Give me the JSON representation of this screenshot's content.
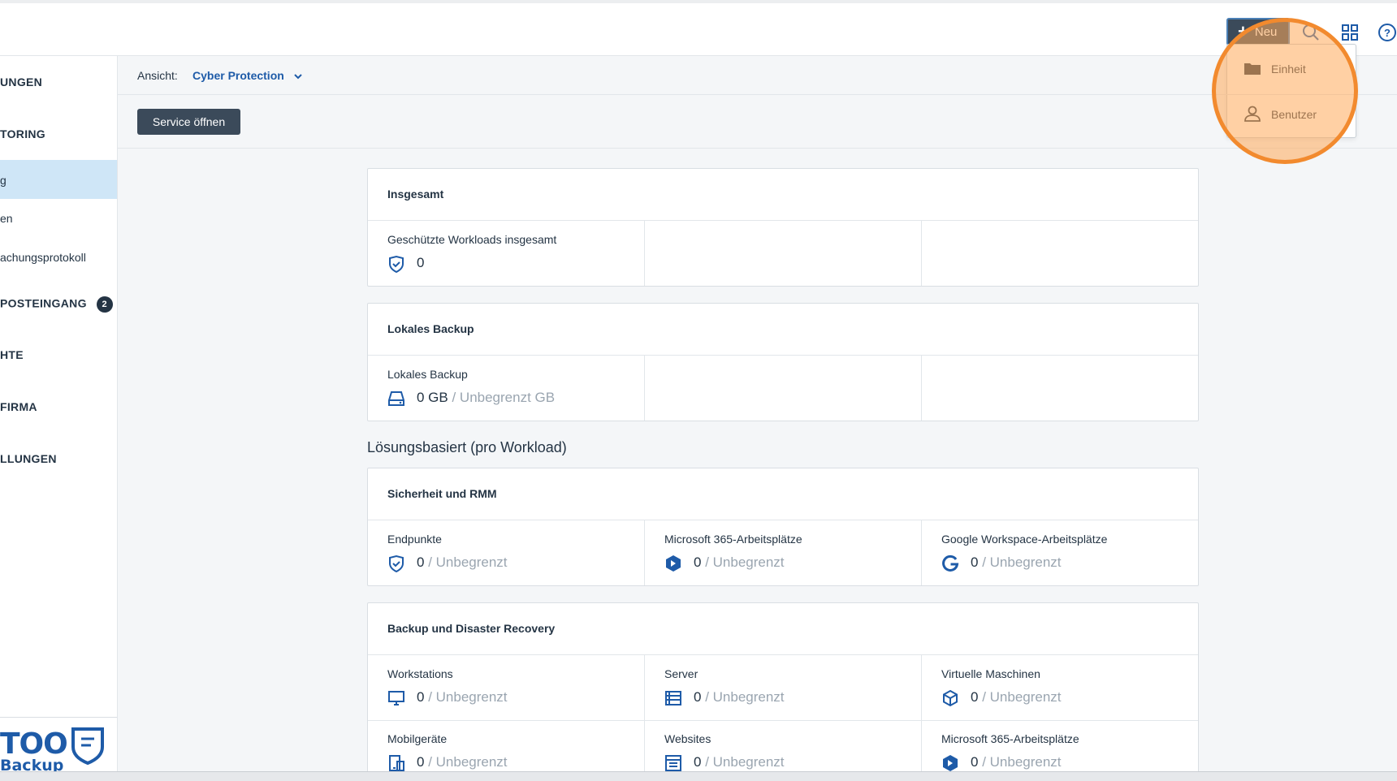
{
  "topbar": {
    "new_label": "Neu",
    "icons": [
      "search-icon",
      "grid-icon",
      "help-icon"
    ]
  },
  "dropdown": {
    "items": [
      {
        "label": "Einheit",
        "icon": "folder-icon"
      },
      {
        "label": "Benutzer",
        "icon": "user-icon"
      }
    ]
  },
  "sidebar": {
    "items": [
      {
        "label": "UNGEN"
      },
      {
        "label": "TORING"
      },
      {
        "label": "g"
      },
      {
        "label": "en"
      },
      {
        "label": "achungsprotokoll"
      },
      {
        "label": "POSTEINGANG",
        "badge": "2"
      },
      {
        "label": "HTE"
      },
      {
        "label": "FIRMA"
      },
      {
        "label": "LLUNGEN"
      }
    ],
    "logo_line1": "TOO",
    "logo_line2": "Backup"
  },
  "viewbar": {
    "label": "Ansicht:",
    "value": "Cyber Protection"
  },
  "service_button": "Service öffnen",
  "cards": {
    "insgesamt": {
      "title": "Insgesamt",
      "cells": [
        {
          "label": "Geschützte Workloads insgesamt",
          "value": "0",
          "limit": "",
          "icon": "shield-icon"
        }
      ]
    },
    "lokales_backup": {
      "title": "Lokales Backup",
      "cells": [
        {
          "label": "Lokales Backup",
          "value": "0 GB",
          "limit": " / Unbegrenzt GB",
          "icon": "drive-icon"
        }
      ]
    },
    "section_title": "Lösungsbasiert (pro Workload)",
    "sicherheit": {
      "title": "Sicherheit und RMM",
      "cells": [
        {
          "label": "Endpunkte",
          "value": "0",
          "limit": " / Unbegrenzt",
          "icon": "shield-icon"
        },
        {
          "label": "Microsoft 365-Arbeitsplätze",
          "value": "0",
          "limit": " / Unbegrenzt",
          "icon": "m365-icon"
        },
        {
          "label": "Google Workspace-Arbeitsplätze",
          "value": "0",
          "limit": " / Unbegrenzt",
          "icon": "google-icon"
        }
      ]
    },
    "backup_dr": {
      "title": "Backup und Disaster Recovery",
      "cells": [
        {
          "label": "Workstations",
          "value": "0",
          "limit": " / Unbegrenzt",
          "icon": "monitor-icon"
        },
        {
          "label": "Server",
          "value": "0",
          "limit": " / Unbegrenzt",
          "icon": "server-icon"
        },
        {
          "label": "Virtuelle Maschinen",
          "value": "0",
          "limit": " / Unbegrenzt",
          "icon": "cube-icon"
        },
        {
          "label": "Mobilgeräte",
          "value": "0",
          "limit": " / Unbegrenzt",
          "icon": "mobile-icon"
        },
        {
          "label": "Websites",
          "value": "0",
          "limit": " / Unbegrenzt",
          "icon": "website-icon"
        },
        {
          "label": "Microsoft 365-Arbeitsplätze",
          "value": "0",
          "limit": " / Unbegrenzt",
          "icon": "m365-icon"
        }
      ]
    }
  },
  "colors": {
    "accent": "#1e5ba8",
    "dark_button": "#3b4a5a",
    "active_row": "#cfe6f7",
    "highlight_ring": "#f28a2e"
  }
}
